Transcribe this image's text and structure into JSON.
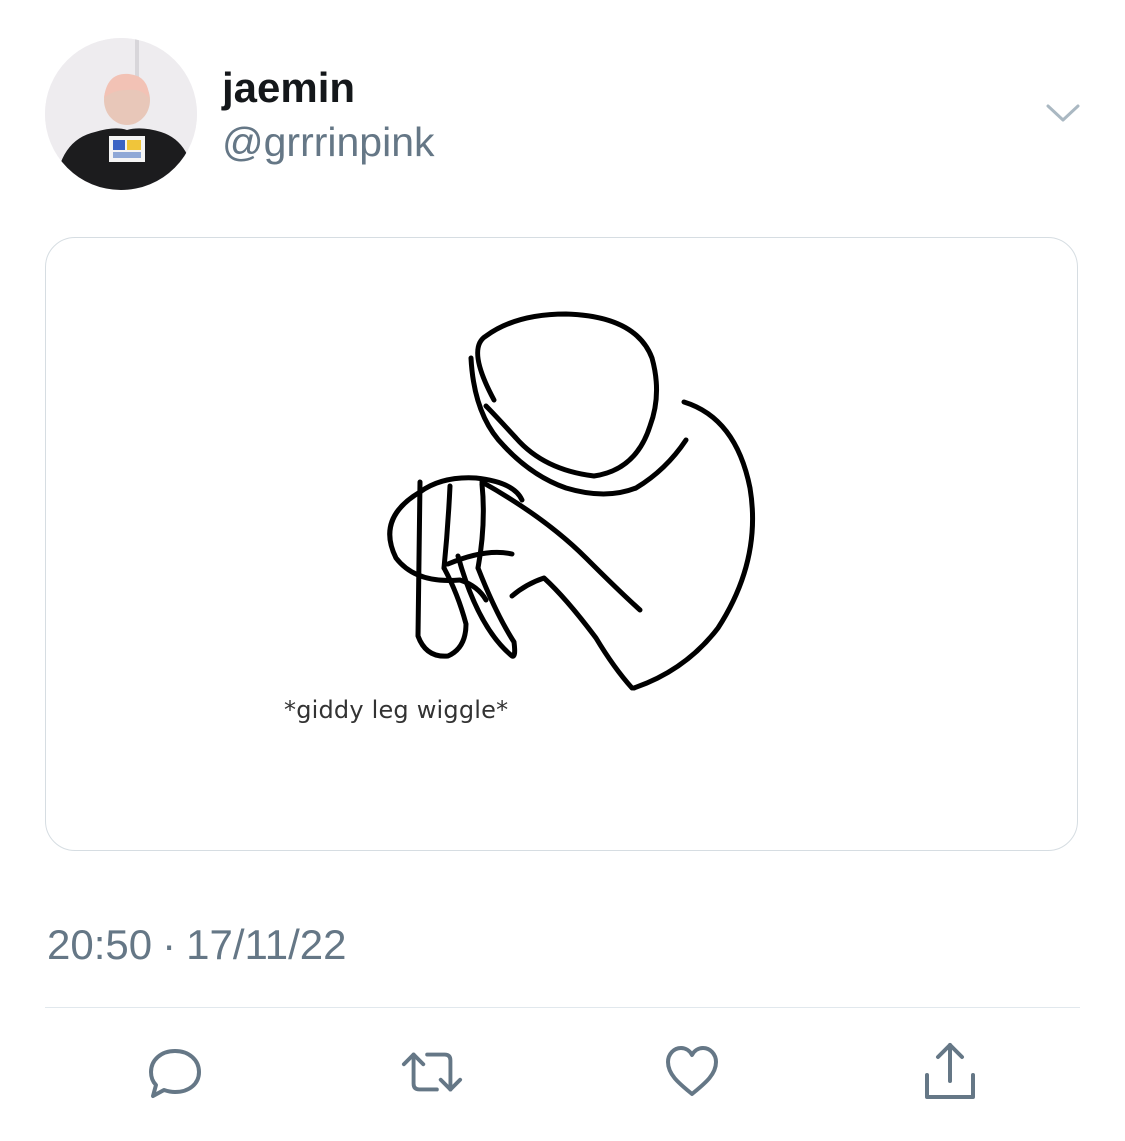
{
  "tweet": {
    "author": {
      "display_name": "jaemin",
      "handle": "@grrrinpink"
    },
    "media": {
      "caption_text": "*giddy leg wiggle*"
    },
    "time": "20:50",
    "separator": "·",
    "date": "17/11/22"
  },
  "icons": {
    "more": "chevron-down-icon",
    "reply": "reply-icon",
    "retweet": "retweet-icon",
    "like": "heart-icon",
    "share": "share-icon"
  },
  "colors": {
    "text_primary": "#14171a",
    "text_secondary": "#657786",
    "icon": "#657786",
    "border": "#d6dde2"
  }
}
